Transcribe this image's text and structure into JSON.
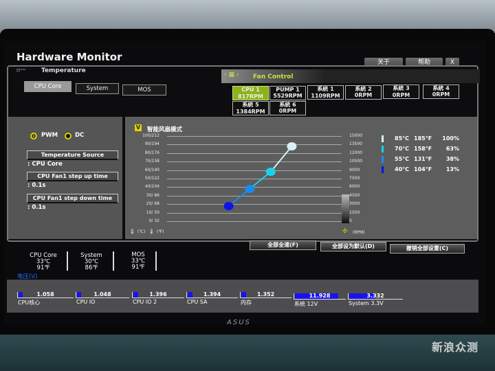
{
  "window": {
    "title": "Hardware Monitor",
    "tabs": [
      "关于",
      "帮助"
    ],
    "close": "X"
  },
  "temperature": {
    "header": "Temperature",
    "sources": [
      "CPU Core",
      "System",
      "MOS"
    ],
    "selected": "CPU Core"
  },
  "fan_control": {
    "header": "Fan Control",
    "fans": [
      {
        "name": "CPU 1",
        "rpm": "817RPM",
        "selected": true
      },
      {
        "name": "PUMP 1",
        "rpm": "5529RPM"
      },
      {
        "name": "系統 1",
        "rpm": "1109RPM"
      },
      {
        "name": "系統 2",
        "rpm": "0RPM"
      },
      {
        "name": "系統 3",
        "rpm": "0RPM"
      },
      {
        "name": "系統 4",
        "rpm": "0RPM"
      },
      {
        "name": "系統 5",
        "rpm": "1384RPM"
      },
      {
        "name": "系統 6",
        "rpm": "0RPM"
      }
    ]
  },
  "mode": {
    "options": [
      "PWM",
      "DC"
    ],
    "selected": "PWM"
  },
  "settings": [
    {
      "label": "Temperature Source",
      "value": ": CPU Core"
    },
    {
      "label": "CPU Fan1 step up time",
      "value": ": 0.1s"
    },
    {
      "label": "CPU Fan1 step down time",
      "value": ": 0.1s"
    }
  ],
  "smart_fan": {
    "label": "智能风扇模式",
    "checked": true,
    "check_glyph": "V"
  },
  "chart_data": {
    "type": "line",
    "left_ticks": [
      "100/212",
      "90/194",
      "80/176",
      "70/158",
      "60/140",
      "50/122",
      "40/104",
      "30/ 86",
      "20/ 68",
      "10/ 50",
      "0/ 32"
    ],
    "right_ticks": [
      "15000",
      "13500",
      "12000",
      "10500",
      "9000",
      "7500",
      "6000",
      "4500",
      "3000",
      "1500",
      "0"
    ],
    "left_unit_c": "(℃)",
    "left_unit_f": "(℉)",
    "right_unit": "(RPM)",
    "points": [
      {
        "temp_c": 40,
        "temp_f": "104°F",
        "temp_label": "40°C",
        "percent": 13,
        "percent_label": "13%",
        "color": "#0a14e8"
      },
      {
        "temp_c": 55,
        "temp_f": "131°F",
        "temp_label": "55°C",
        "percent": 38,
        "percent_label": "38%",
        "color": "#1a8cf0"
      },
      {
        "temp_c": 70,
        "temp_f": "158°F",
        "temp_label": "70°C",
        "percent": 63,
        "percent_label": "63%",
        "color": "#18d2ea"
      },
      {
        "temp_c": 85,
        "temp_f": "185°F",
        "temp_label": "85°C",
        "percent": 100,
        "percent_label": "100%",
        "color": "#d8f2f4"
      }
    ]
  },
  "actions": [
    "全部全速(F)",
    "全部设为默认(D)",
    "撤销全部设置(C)"
  ],
  "readings": [
    {
      "name": "CPU Core",
      "c": "33℃",
      "f": "91℉"
    },
    {
      "name": "System",
      "c": "30℃",
      "f": "86℉"
    },
    {
      "name": "MOS",
      "c": "33℃",
      "f": "91℉"
    }
  ],
  "voltage": {
    "header": "电压(V)",
    "items": [
      {
        "name": "CPU核心",
        "value": "1.058",
        "fill": 0.08
      },
      {
        "name": "CPU IO",
        "value": "1.048",
        "fill": 0.08
      },
      {
        "name": "CPU IO 2",
        "value": "1.396",
        "fill": 0.1
      },
      {
        "name": "CPU SA",
        "value": "1.394",
        "fill": 0.1
      },
      {
        "name": "内存",
        "value": "1.352",
        "fill": 0.1
      },
      {
        "name": "系統 12V",
        "value": "11.928",
        "fill": 0.88
      },
      {
        "name": "System 3.3V",
        "value": "3.332",
        "fill": 0.5
      }
    ]
  },
  "monitor_brand": "ASUS",
  "watermark": "新浪众测"
}
